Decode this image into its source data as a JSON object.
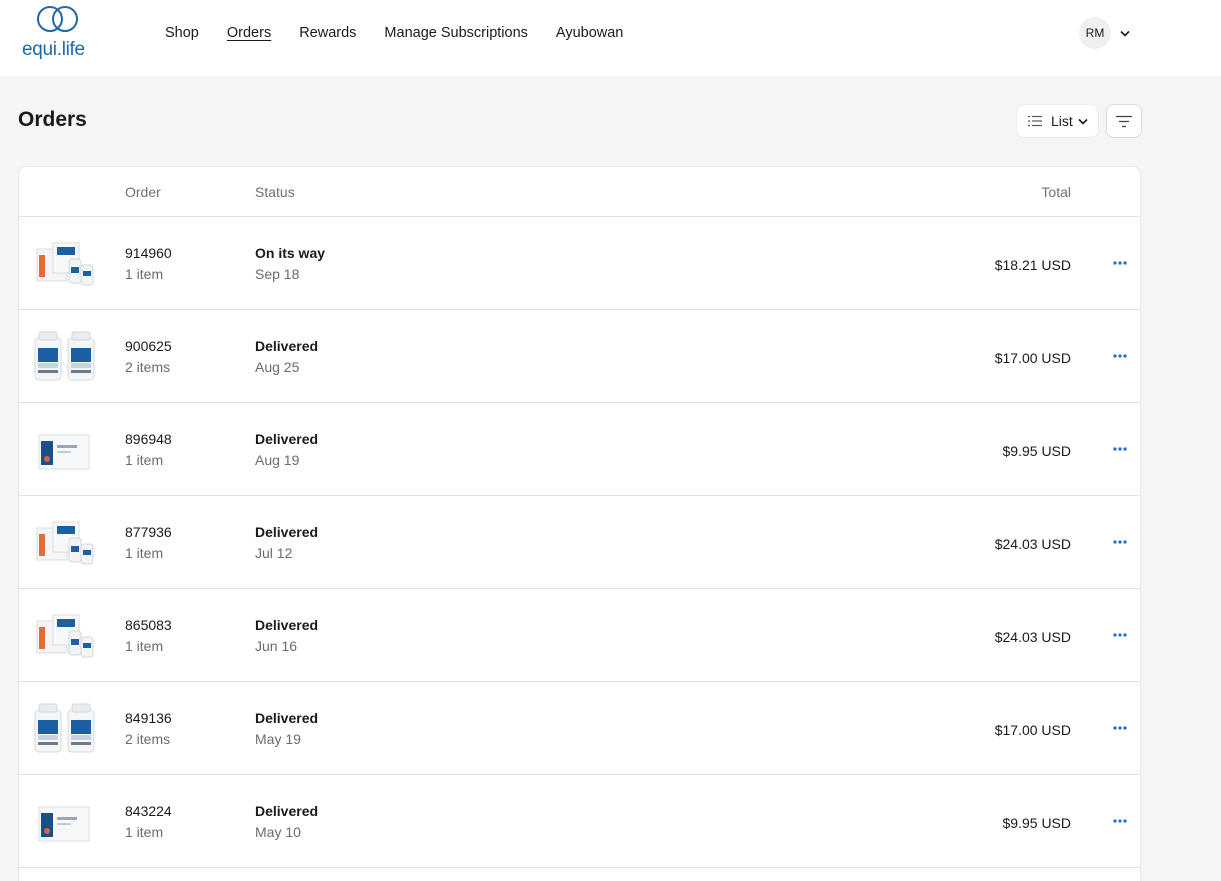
{
  "brand": {
    "name": "equi.life",
    "accent": "#1f6aa5"
  },
  "nav": [
    {
      "label": "Shop",
      "active": false
    },
    {
      "label": "Orders",
      "active": true
    },
    {
      "label": "Rewards",
      "active": false
    },
    {
      "label": "Manage Subscriptions",
      "active": false
    },
    {
      "label": "Ayubowan",
      "active": false
    }
  ],
  "account": {
    "initials": "RM",
    "icon": "chevron-down-icon"
  },
  "page": {
    "title": "Orders",
    "view_label": "List",
    "view_icon": "list-icon",
    "filter_icon": "filter-icon"
  },
  "table": {
    "columns": {
      "order": "Order",
      "status": "Status",
      "total": "Total"
    },
    "rows": [
      {
        "number": "914960",
        "items": "1 item",
        "status": "On its way",
        "date": "Sep 18",
        "total": "$18.21 USD",
        "thumbnail": "kit"
      },
      {
        "number": "900625",
        "items": "2 items",
        "status": "Delivered",
        "date": "Aug 25",
        "total": "$17.00 USD",
        "thumbnail": "bottles"
      },
      {
        "number": "896948",
        "items": "1 item",
        "status": "Delivered",
        "date": "Aug 19",
        "total": "$9.95 USD",
        "thumbnail": "box"
      },
      {
        "number": "877936",
        "items": "1 item",
        "status": "Delivered",
        "date": "Jul 12",
        "total": "$24.03 USD",
        "thumbnail": "kit"
      },
      {
        "number": "865083",
        "items": "1 item",
        "status": "Delivered",
        "date": "Jun 16",
        "total": "$24.03 USD",
        "thumbnail": "kit"
      },
      {
        "number": "849136",
        "items": "2 items",
        "status": "Delivered",
        "date": "May 19",
        "total": "$17.00 USD",
        "thumbnail": "bottles"
      },
      {
        "number": "843224",
        "items": "1 item",
        "status": "Delivered",
        "date": "May 10",
        "total": "$9.95 USD",
        "thumbnail": "box"
      }
    ]
  },
  "colors": {
    "link_blue": "#1a6bd0",
    "muted_text": "#6b6b6b",
    "page_bg": "#f5f5f5"
  }
}
